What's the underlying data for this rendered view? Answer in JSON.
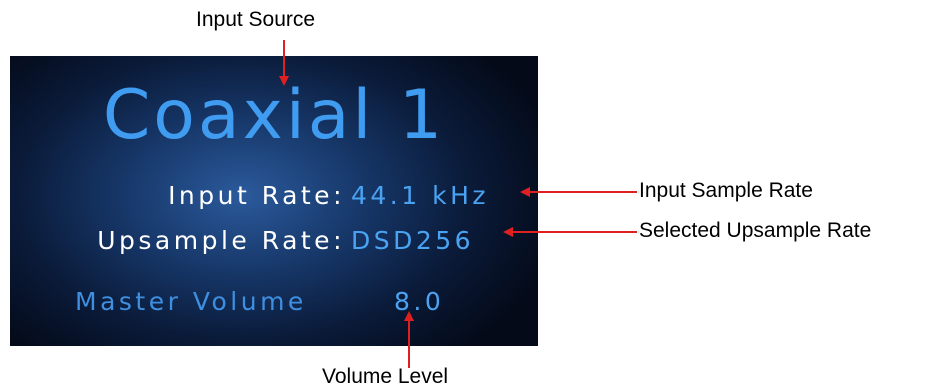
{
  "display": {
    "source": "Coaxial 1",
    "input_rate_label": "Input Rate:",
    "input_rate_value": "44.1 kHz",
    "upsample_rate_label": "Upsample Rate:",
    "upsample_rate_value": "DSD256",
    "master_volume_label": "Master Volume",
    "master_volume_value": "8.0"
  },
  "callouts": {
    "input_source": "Input Source",
    "input_sample_rate": "Input Sample Rate",
    "selected_upsample_rate": "Selected Upsample Rate",
    "volume_level": "Volume Level"
  },
  "colors": {
    "arrow": "#e02020",
    "display_text_blue": "#3f9cf0",
    "display_text_white": "#ffffff",
    "display_background": "#0a1a38"
  }
}
